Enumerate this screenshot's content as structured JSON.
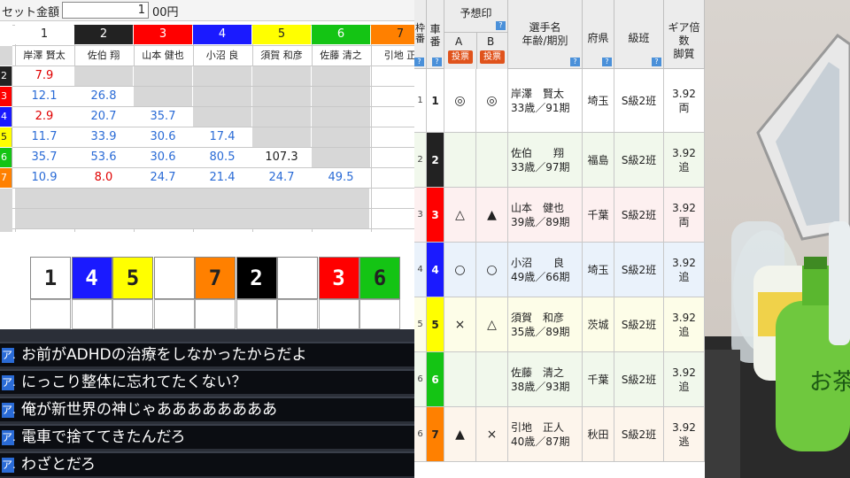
{
  "spreadsheet": {
    "set_label": "セット金額",
    "set_value": "1",
    "set_unit": "00円",
    "col_numbers": [
      "1",
      "2",
      "3",
      "4",
      "5",
      "6",
      "7"
    ],
    "col_colors": [
      "#ffffff",
      "#222222",
      "#ff0000",
      "#1a1aff",
      "#ffff00",
      "#14c414",
      "#ff8000"
    ],
    "col_names": [
      "岸澤 賢太",
      "佐伯 翔",
      "山本 健也",
      "小沼 良",
      "須賀 和彦",
      "佐藤 清之",
      "引地 正"
    ],
    "row_numbers": [
      "2",
      "3",
      "4",
      "5",
      "6",
      "7"
    ],
    "row_colors": [
      "#222222",
      "#ff0000",
      "#1a1aff",
      "#ffff00",
      "#14c414",
      "#ff8000"
    ],
    "rows": [
      [
        "7.9",
        "",
        "",
        "",
        "",
        ""
      ],
      [
        "12.1",
        "26.8",
        "",
        "",
        "",
        ""
      ],
      [
        "2.9",
        "20.7",
        "35.7",
        "",
        "",
        ""
      ],
      [
        "11.7",
        "33.9",
        "30.6",
        "17.4",
        "",
        ""
      ],
      [
        "35.7",
        "53.6",
        "30.6",
        "80.5",
        "107.3",
        ""
      ],
      [
        "10.9",
        "8.0",
        "24.7",
        "21.4",
        "24.7",
        "49.5"
      ]
    ],
    "row_text_colors": [
      [
        "#e00000"
      ],
      [
        "#2a6bd6",
        "#2a6bd6"
      ],
      [
        "#e00000",
        "#2a6bd6",
        "#2a6bd6"
      ],
      [
        "#2a6bd6",
        "#2a6bd6",
        "#2a6bd6",
        "#2a6bd6"
      ],
      [
        "#2a6bd6",
        "#2a6bd6",
        "#2a6bd6",
        "#2a6bd6",
        "#222222"
      ],
      [
        "#2a6bd6",
        "#e00000",
        "#2a6bd6",
        "#2a6bd6",
        "#2a6bd6",
        "#2a6bd6"
      ]
    ]
  },
  "prediction_boxes": [
    {
      "num": "1",
      "bg": "#ffffff",
      "fg": "#222222"
    },
    {
      "num": "4",
      "bg": "#1a1aff",
      "fg": "#ffffff"
    },
    {
      "num": "5",
      "bg": "#ffff00",
      "fg": "#222222"
    },
    {
      "num": "",
      "bg": "#ffffff",
      "fg": "#222222"
    },
    {
      "num": "7",
      "bg": "#ff8000",
      "fg": "#222222"
    },
    {
      "num": "2",
      "bg": "#000000",
      "fg": "#ffffff"
    },
    {
      "num": "",
      "bg": "#ffffff",
      "fg": "#222222"
    },
    {
      "num": "3",
      "bg": "#ff0000",
      "fg": "#ffffff"
    },
    {
      "num": "6",
      "bg": "#14c414",
      "fg": "#222222"
    }
  ],
  "chat": {
    "icon_label": "ア.",
    "messages": [
      "お前がADHDの治療をしなかったからだよ",
      "にっこり整体に忘れてたくない？",
      "俺が新世界の神じゃああああああああ",
      "電車で捨ててきたんだろ",
      "わざとだろ"
    ]
  },
  "race_table": {
    "h_frame": "枠番",
    "h_car": "車番",
    "h_pred": "予想印",
    "h_a": "A",
    "h_b": "B",
    "vote": "投票",
    "h_name": "選手名\n年齢/期別",
    "h_pref": "府県",
    "h_class": "級班",
    "h_gear": "ギア倍数\n脚質",
    "riders": [
      {
        "frame": "1",
        "car": "1",
        "color": "#ffffff",
        "fg": "#222222",
        "a": "◎",
        "b": "◎",
        "name": "岸澤　賢太",
        "age": "33歳／91期",
        "pref": "埼玉",
        "class": "S級2班",
        "gear": "3.92",
        "style": "両",
        "bg": "#ffffff"
      },
      {
        "frame": "2",
        "car": "2",
        "color": "#222222",
        "fg": "#ffffff",
        "a": "",
        "b": "",
        "name": "佐伯　　翔",
        "age": "33歳／97期",
        "pref": "福島",
        "class": "S級2班",
        "gear": "3.92",
        "style": "追",
        "bg": "#f1f8ec"
      },
      {
        "frame": "3",
        "car": "3",
        "color": "#ff0000",
        "fg": "#ffffff",
        "a": "△",
        "b": "▲",
        "name": "山本　健也",
        "age": "39歳／89期",
        "pref": "千葉",
        "class": "S級2班",
        "gear": "3.92",
        "style": "両",
        "bg": "#fdf0f0"
      },
      {
        "frame": "4",
        "car": "4",
        "color": "#1a1aff",
        "fg": "#ffffff",
        "a": "○",
        "b": "○",
        "name": "小沼　　良",
        "age": "49歳／66期",
        "pref": "埼玉",
        "class": "S級2班",
        "gear": "3.92",
        "style": "追",
        "bg": "#eaf2fb"
      },
      {
        "frame": "5",
        "car": "5",
        "color": "#ffff00",
        "fg": "#222222",
        "a": "×",
        "b": "△",
        "name": "須賀　和彦",
        "age": "35歳／89期",
        "pref": "茨城",
        "class": "S級2班",
        "gear": "3.92",
        "style": "追",
        "bg": "#fdfde8"
      },
      {
        "frame": "6",
        "car": "6",
        "color": "#14c414",
        "fg": "#ffffff",
        "a": "",
        "b": "",
        "name": "佐藤　清之",
        "age": "38歳／93期",
        "pref": "千葉",
        "class": "S級2班",
        "gear": "3.92",
        "style": "追",
        "bg": "#f1f8ec"
      },
      {
        "frame": "6",
        "car": "7",
        "color": "#ff8000",
        "fg": "#222222",
        "a": "▲",
        "b": "×",
        "name": "引地　正人",
        "age": "40歳／87期",
        "pref": "秋田",
        "class": "S級2班",
        "gear": "3.92",
        "style": "逃",
        "bg": "#fdf5ec"
      }
    ]
  }
}
